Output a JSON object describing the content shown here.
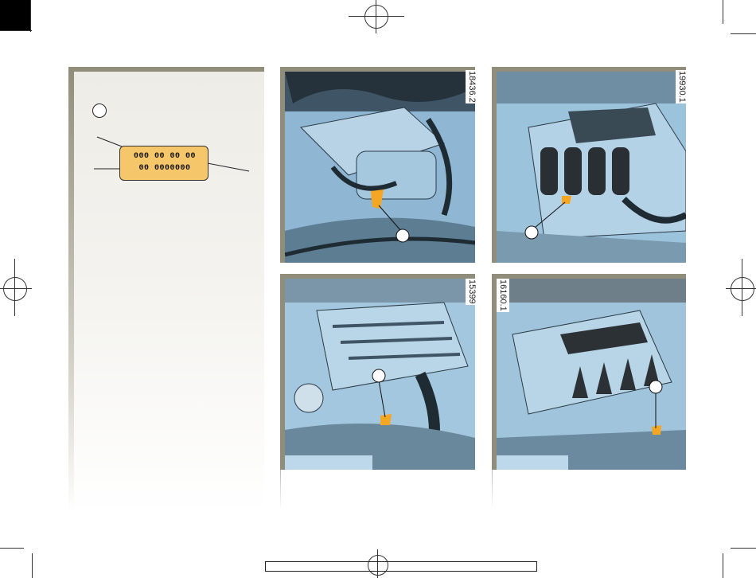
{
  "plate": {
    "line1": "000 00 00 00",
    "line2": "00 0000000"
  },
  "photos": [
    {
      "ref": "18436.2"
    },
    {
      "ref": "19930.1"
    },
    {
      "ref": "15399"
    },
    {
      "ref": "16160.1"
    }
  ],
  "colors": {
    "frame": "#908d7a",
    "highlight": "#f5a623",
    "engine_blue": "#9fc4dc"
  }
}
